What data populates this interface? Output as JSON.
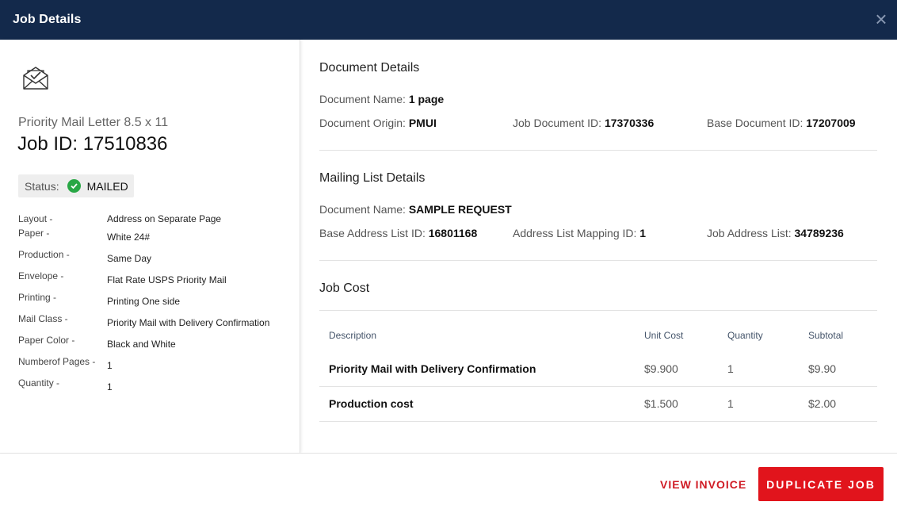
{
  "modal": {
    "title": "Job Details",
    "close_icon": "close-icon"
  },
  "left": {
    "icon": "envelope-check-icon",
    "product_name": "Priority Mail Letter 8.5 x 11",
    "job_id": "Job ID: 17510836",
    "status": {
      "label": "Status:",
      "value": "MAILED",
      "color": "#28a745"
    },
    "specs": [
      {
        "label": "Layout -",
        "value": "Address on Separate Page"
      },
      {
        "label": "Paper -",
        "value": "White 24#"
      },
      {
        "label": "Production -",
        "value": "Same Day"
      },
      {
        "label": "Envelope -",
        "value": "Flat Rate USPS Priority Mail"
      },
      {
        "label": "Printing -",
        "value": "Printing One side"
      },
      {
        "label": "Mail Class -",
        "value": "Priority Mail with Delivery Confirmation"
      },
      {
        "label": "Paper Color -",
        "value": "Black and White"
      },
      {
        "label": "Numberof Pages -",
        "value": "1"
      },
      {
        "label": "Quantity -",
        "value": "1"
      }
    ]
  },
  "document_details": {
    "title": "Document Details",
    "document_name": {
      "label": "Document Name:",
      "value": "1 page"
    },
    "document_origin": {
      "label": "Document Origin:",
      "value": "PMUI"
    },
    "job_document_id": {
      "label": "Job Document ID:",
      "value": "17370336"
    },
    "base_document_id": {
      "label": "Base Document ID:",
      "value": "17207009"
    }
  },
  "mailing_list_details": {
    "title": "Mailing List Details",
    "document_name": {
      "label": "Document Name:",
      "value": "SAMPLE REQUEST"
    },
    "base_address_list_id": {
      "label": "Base Address List ID:",
      "value": "16801168"
    },
    "address_list_mapping_id": {
      "label": "Address List Mapping ID:",
      "value": "1"
    },
    "job_address_list": {
      "label": "Job Address List:",
      "value": "34789236"
    }
  },
  "job_cost": {
    "title": "Job Cost",
    "headers": {
      "description": "Description",
      "unit_cost": "Unit Cost",
      "quantity": "Quantity",
      "subtotal": "Subtotal"
    },
    "rows": [
      {
        "description": "Priority Mail with Delivery Confirmation",
        "unit_cost": "$9.900",
        "quantity": "1",
        "subtotal": "$9.90"
      },
      {
        "description": "Production cost",
        "unit_cost": "$1.500",
        "quantity": "1",
        "subtotal": "$2.00"
      }
    ]
  },
  "footer": {
    "view_invoice": "VIEW INVOICE",
    "duplicate_job": "DUPLICATE JOB"
  },
  "colors": {
    "header_bg": "#13294b",
    "accent": "#e1141c",
    "link": "#d01c25"
  }
}
